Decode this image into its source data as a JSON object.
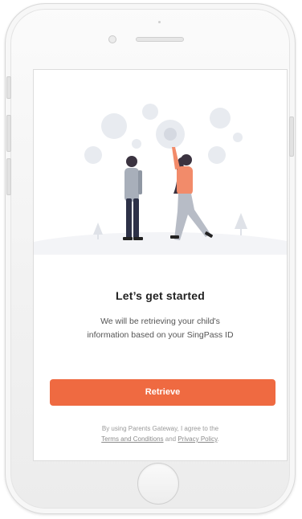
{
  "onboarding": {
    "title": "Let’s get started",
    "subtitle_line1": "We will be retrieving your child's",
    "subtitle_line2": "information based on your SingPass ID",
    "retrieve_label": "Retrieve",
    "consent_prefix": "By using Parents Gateway, I agree to the",
    "terms_label": "Terms and Conditions",
    "consent_and": "and",
    "privacy_label": "Privacy Policy",
    "consent_end": "."
  },
  "colors": {
    "accent": "#ef6a41",
    "man_shirt": "#a8afba",
    "man_pants": "#2d3147",
    "woman_top": "#f28b6a",
    "woman_pants": "#b7bcc6",
    "bubbles": "#e6e9ef"
  },
  "icons": {
    "hero": "people-reaching-bubbles-illustration"
  }
}
